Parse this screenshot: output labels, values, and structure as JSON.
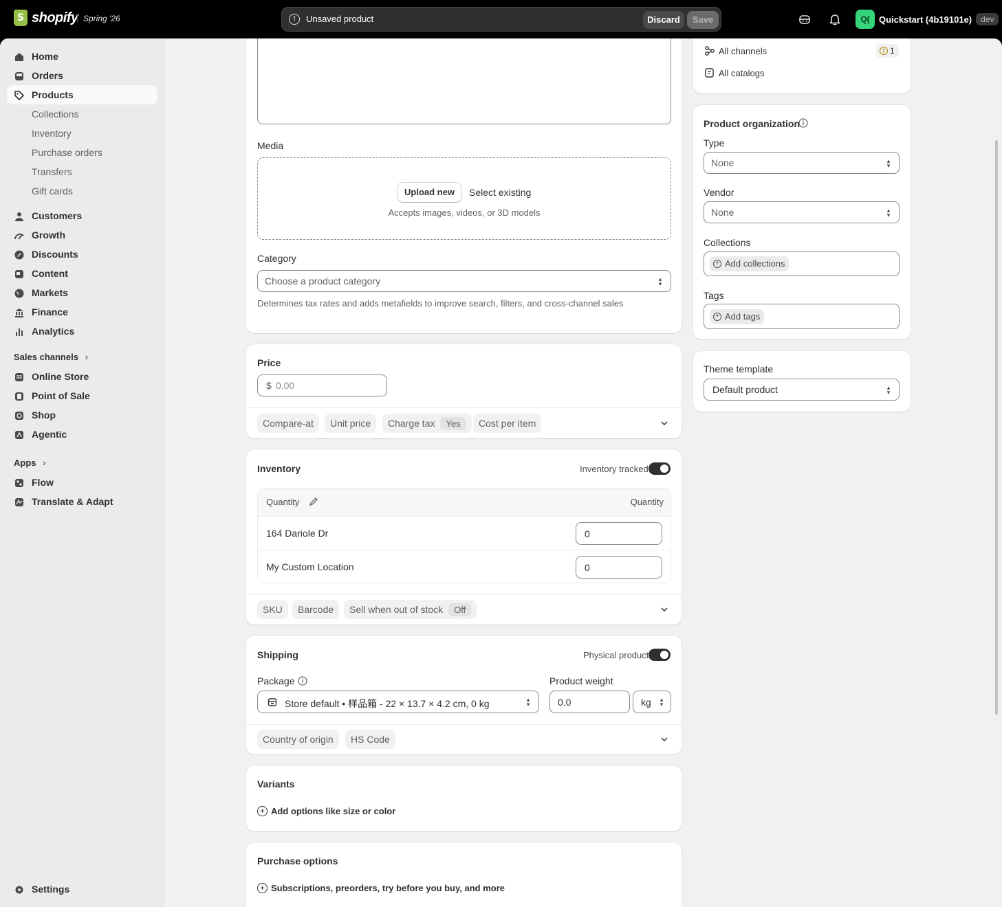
{
  "topbar": {
    "brand": "shopify",
    "edition": "Spring '26",
    "save_bar": {
      "message": "Unsaved product",
      "discard_label": "Discard",
      "save_label": "Save"
    },
    "store": {
      "initials": "Q(",
      "name": "Quickstart (4b19101e)",
      "badge": "dev"
    }
  },
  "sidebar": {
    "items": [
      {
        "label": "Home",
        "icon": "home-icon"
      },
      {
        "label": "Orders",
        "icon": "inbox-icon"
      },
      {
        "label": "Products",
        "icon": "tag-icon",
        "active": true
      }
    ],
    "product_subitems": [
      "Collections",
      "Inventory",
      "Purchase orders",
      "Transfers",
      "Gift cards"
    ],
    "items2": [
      {
        "label": "Customers",
        "icon": "person-icon"
      },
      {
        "label": "Growth",
        "icon": "growth-icon"
      },
      {
        "label": "Discounts",
        "icon": "discount-icon"
      },
      {
        "label": "Content",
        "icon": "content-icon"
      },
      {
        "label": "Markets",
        "icon": "globe-icon"
      },
      {
        "label": "Finance",
        "icon": "bank-icon"
      },
      {
        "label": "Analytics",
        "icon": "chart-bar-icon"
      }
    ],
    "sales_channels_label": "Sales channels",
    "channels": [
      {
        "label": "Online Store",
        "icon": "store-icon"
      },
      {
        "label": "Point of Sale",
        "icon": "pos-icon"
      },
      {
        "label": "Shop",
        "icon": "shop-icon"
      },
      {
        "label": "Agentic",
        "icon": "agentic-icon"
      }
    ],
    "apps_label": "Apps",
    "apps": [
      {
        "label": "Flow",
        "icon": "flow-icon"
      },
      {
        "label": "Translate & Adapt",
        "icon": "translate-icon"
      }
    ],
    "settings_label": "Settings"
  },
  "media": {
    "label": "Media",
    "upload_label": "Upload new",
    "select_label": "Select existing",
    "hint": "Accepts images, videos, or 3D models"
  },
  "category": {
    "label": "Category",
    "placeholder": "Choose a product category",
    "hint": "Determines tax rates and adds metafields to improve search, filters, and cross-channel sales"
  },
  "price": {
    "title": "Price",
    "currency": "$",
    "placeholder": "0.00",
    "pills": {
      "compare_at": "Compare-at",
      "unit_price": "Unit price",
      "charge_tax": "Charge tax",
      "charge_tax_value": "Yes",
      "cost": "Cost per item"
    }
  },
  "inventory": {
    "title": "Inventory",
    "tracked_label": "Inventory tracked",
    "tracked": true,
    "col_left": "Quantity",
    "col_right": "Quantity",
    "locations": [
      {
        "name": "164 Dariole Dr",
        "qty": "0"
      },
      {
        "name": "My Custom Location",
        "qty": "0"
      }
    ],
    "pills": {
      "sku": "SKU",
      "barcode": "Barcode",
      "sell_oos": "Sell when out of stock",
      "sell_oos_value": "Off"
    }
  },
  "shipping": {
    "title": "Shipping",
    "physical_label": "Physical product",
    "physical": true,
    "package_label": "Package",
    "package_value": "Store default • 样品箱 - 22 × 13.7 × 4.2 cm, 0 kg",
    "weight_label": "Product weight",
    "weight_value": "0.0",
    "weight_unit": "kg",
    "pills": {
      "origin": "Country of origin",
      "hs": "HS Code"
    }
  },
  "variants": {
    "title": "Variants",
    "add_label": "Add options like size or color"
  },
  "purchase_options": {
    "title": "Purchase options",
    "add_label": "Subscriptions, preorders, try before you buy, and more"
  },
  "publishing": {
    "channels_label": "All channels",
    "channels_count": "1",
    "catalogs_label": "All catalogs"
  },
  "organization": {
    "title": "Product organization",
    "type_label": "Type",
    "type_value": "None",
    "vendor_label": "Vendor",
    "vendor_value": "None",
    "collections_label": "Collections",
    "collections_add": "Add collections",
    "tags_label": "Tags",
    "tags_add": "Add tags"
  },
  "theme": {
    "title": "Theme template",
    "value": "Default product"
  }
}
